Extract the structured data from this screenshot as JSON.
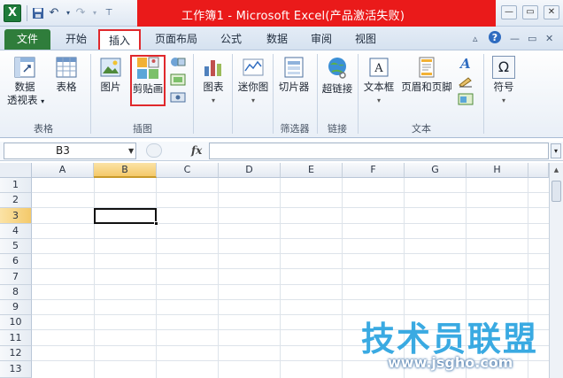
{
  "titlebar": {
    "app_icon": "excel-icon",
    "title": "工作簿1 - Microsoft Excel(产品激活失败)",
    "accent": "#ea1a1a",
    "quick_access": [
      "save-icon",
      "undo-icon",
      "redo-icon",
      "customize-icon"
    ],
    "window_buttons": [
      "minimize-icon",
      "restore-icon",
      "close-icon"
    ]
  },
  "tabs": {
    "items": [
      "文件",
      "开始",
      "插入",
      "页面布局",
      "公式",
      "数据",
      "审阅",
      "视图"
    ],
    "active": "插入",
    "file_color": "#2f7d3b"
  },
  "ribbon": {
    "groups": {
      "tables": {
        "label": "表格",
        "pivot_label_1": "数据",
        "pivot_label_2": "透视表",
        "table_label": "表格"
      },
      "illustrations": {
        "label": "插图",
        "picture_label": "图片",
        "clipart_label": "剪贴画"
      },
      "charts": {
        "chart_label": "图表"
      },
      "sparklines": {
        "sparkline_label": "迷你图"
      },
      "filter": {
        "label": "筛选器",
        "slicer_label": "切片器"
      },
      "links": {
        "label": "链接",
        "hyperlink_label": "超链接"
      },
      "text": {
        "label": "文本",
        "textbox_label": "文本框",
        "header_footer_label": "页眉和页脚"
      },
      "symbols": {
        "symbol_label": "符号",
        "symbol_glyph": "Ω"
      }
    }
  },
  "formula_bar": {
    "name_box": "B3",
    "fx": "fx",
    "value": ""
  },
  "sheet": {
    "columns": [
      "A",
      "B",
      "C",
      "D",
      "E",
      "F",
      "G",
      "H"
    ],
    "rows": [
      "1",
      "2",
      "3",
      "4",
      "5",
      "6",
      "7",
      "8",
      "9",
      "10",
      "11",
      "12",
      "13"
    ],
    "active_cell": "B3"
  },
  "watermark": {
    "text": "技术员联盟",
    "url": "www.jsgho.com"
  }
}
